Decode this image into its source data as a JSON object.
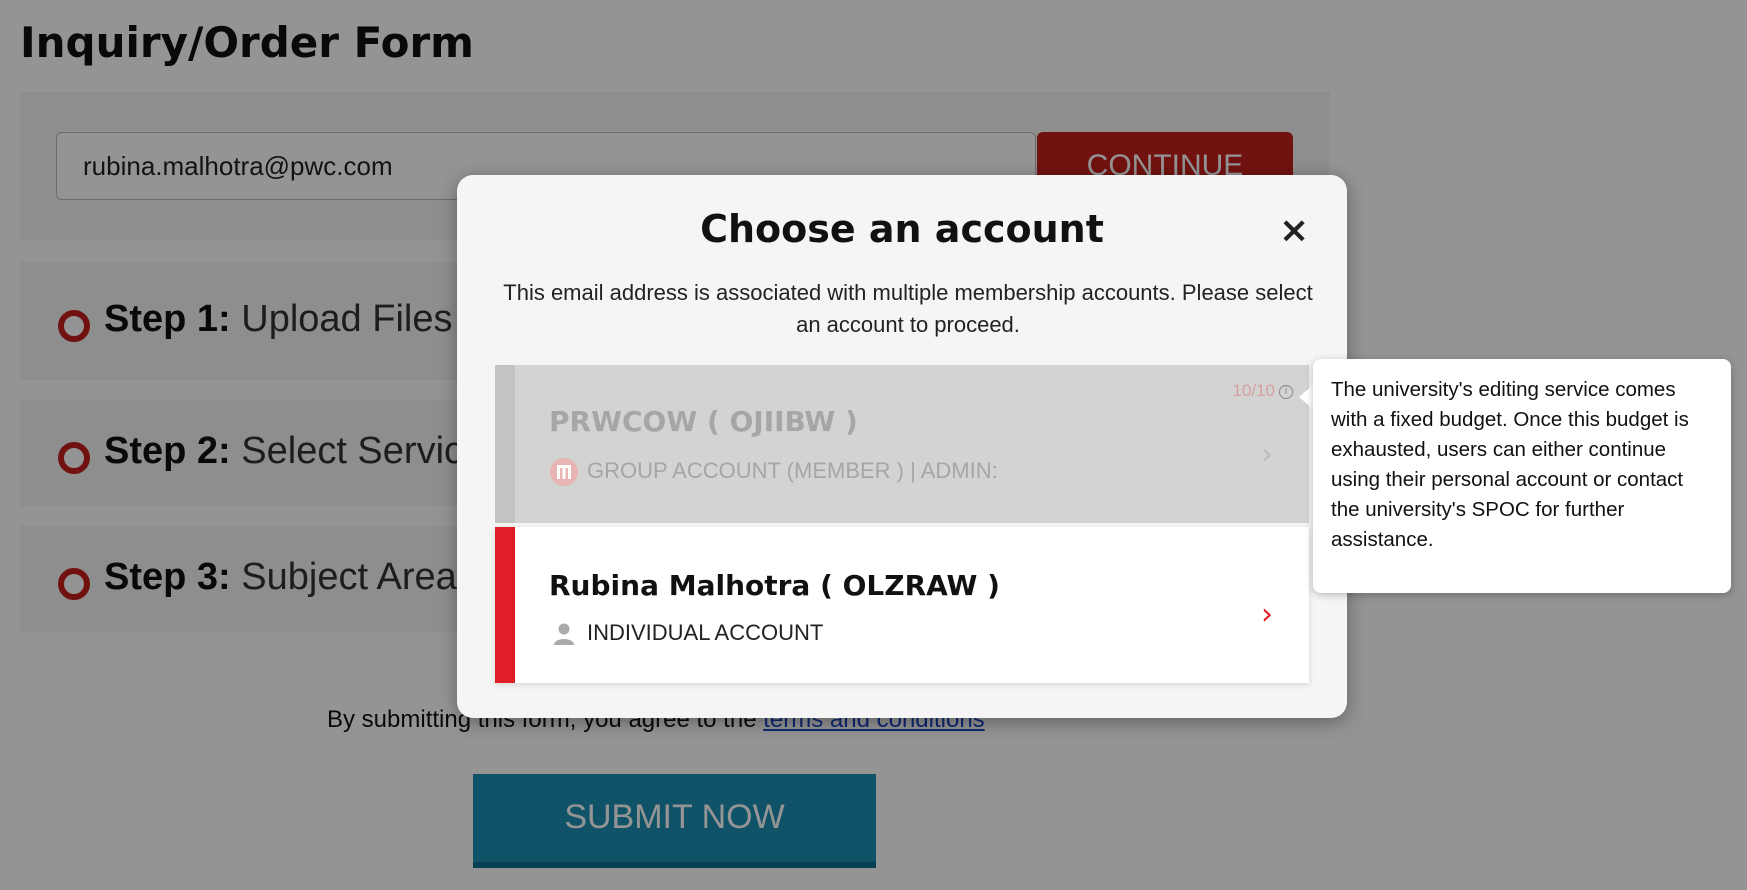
{
  "page": {
    "title": "Inquiry/Order Form",
    "email_value": "rubina.malhotra@pwc.com",
    "continue_label": "CONTINUE",
    "steps": [
      {
        "number": "Step 1:",
        "label": "Upload Files"
      },
      {
        "number": "Step 2:",
        "label": "Select Service"
      },
      {
        "number": "Step 3:",
        "label": "Subject Area"
      }
    ],
    "terms_prefix": "By submitting this form, you agree to the ",
    "terms_link": "terms and conditions",
    "submit_label": "SUBMIT NOW"
  },
  "modal": {
    "title": "Choose an account",
    "close_icon": "close-icon",
    "description": "This email address is associated with multiple membership accounts. Please select an account to proceed.",
    "accounts": [
      {
        "name": "PRWCOW ( OJIIBW )",
        "type": "GROUP ACCOUNT (MEMBER )  | ADMIN:",
        "budget": "10/10",
        "icon": "group-logo-icon",
        "disabled": true
      },
      {
        "name": "Rubina Malhotra ( OLZRAW )",
        "type": "INDIVIDUAL ACCOUNT",
        "icon": "user-icon",
        "disabled": false
      }
    ]
  },
  "tooltip": {
    "text": "The university's editing service comes with a fixed budget. Once this budget is exhausted, users can either continue using their personal account or contact the university's SPOC for further assistance."
  },
  "colors": {
    "accent_red": "#c4201c",
    "account_red": "#e01e28",
    "submit_blue": "#1c8fb5",
    "link_blue": "#1a47c9"
  }
}
